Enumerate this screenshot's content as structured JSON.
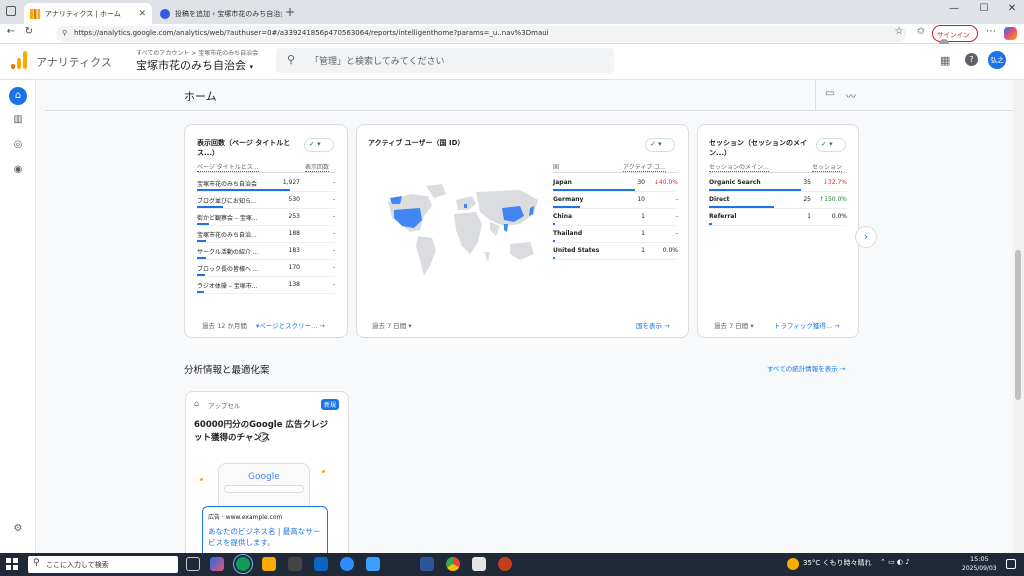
{
  "browser": {
    "tabs": [
      {
        "title": "アナリティクス | ホーム",
        "active": true
      },
      {
        "title": "投稿を追加 ‹ 宝塚市花のみち自治会",
        "active": false
      }
    ],
    "url": "https://analytics.google.com/analytics/web/?authuser=0#/a339241856p470563064/reports/intelligenthome?params=_u..nav%3Dmaui",
    "signin_label": "サインイン"
  },
  "ga": {
    "product": "アナリティクス",
    "breadcrumb": "すべてのアカウント > 宝塚市花のみち自治会",
    "property": "宝塚市花のみち自治会",
    "search_placeholder": "「管理」と検索してみてください",
    "avatar": "弘之"
  },
  "page": {
    "title": "ホーム"
  },
  "card_pages": {
    "title": "表示回数（ページ タイトルとス...）",
    "col1": "ページ タイトルとス...",
    "col2": "表示回数",
    "rows": [
      {
        "label": "宝塚市花のみち自治会",
        "value": "1,927",
        "delta": "-",
        "pct": 1.0
      },
      {
        "label": "ブログ並びにお知ら...",
        "value": "530",
        "delta": "-",
        "pct": 0.28
      },
      {
        "label": "街かど観察会 – 宝塚...",
        "value": "253",
        "delta": "-",
        "pct": 0.13
      },
      {
        "label": "宝塚市花のみち自治...",
        "value": "188",
        "delta": "-",
        "pct": 0.1
      },
      {
        "label": "サークル活動の紹介 ...",
        "value": "183",
        "delta": "-",
        "pct": 0.1
      },
      {
        "label": "ブロック長の皆様へ ...",
        "value": "170",
        "delta": "-",
        "pct": 0.09
      },
      {
        "label": "ラジオ体操 – 宝塚市...",
        "value": "138",
        "delta": "-",
        "pct": 0.07
      }
    ],
    "period": "過去 12 か月間",
    "link": "ページとスクリー..."
  },
  "card_users": {
    "title": "アクティブ ユーザー（国 ID）",
    "col1": "国",
    "col2": "アクティブ ユ...",
    "rows": [
      {
        "label": "Japan",
        "value": "30",
        "delta": "↓40.0%",
        "dir": "down",
        "pct": 1.0
      },
      {
        "label": "Germany",
        "value": "10",
        "delta": "-",
        "dir": "none",
        "pct": 0.33
      },
      {
        "label": "China",
        "value": "1",
        "delta": "-",
        "dir": "none",
        "pct": 0.03
      },
      {
        "label": "Thailand",
        "value": "1",
        "delta": "-",
        "dir": "none",
        "pct": 0.03
      },
      {
        "label": "United States",
        "value": "1",
        "delta": "0.0%",
        "dir": "none",
        "pct": 0.03
      }
    ],
    "period": "過去 7 日間",
    "link": "国を表示"
  },
  "card_sessions": {
    "title": "セッション（セッションのメイン...）",
    "col1": "セッションのメイン...",
    "col2": "セッション",
    "rows": [
      {
        "label": "Organic Search",
        "value": "35",
        "delta": "↓32.7%",
        "dir": "down",
        "pct": 1.0
      },
      {
        "label": "Direct",
        "value": "25",
        "delta": "↑150.0%",
        "dir": "up",
        "pct": 0.71
      },
      {
        "label": "Referral",
        "value": "1",
        "delta": "0.0%",
        "dir": "none",
        "pct": 0.03
      }
    ],
    "period": "過去 7 日間",
    "link": "トラフィック獲得..."
  },
  "insights": {
    "title": "分析情報と最適化案",
    "link": "すべての統計情報を表示",
    "card": {
      "tag": "アップセル",
      "badge": "新規",
      "headline": "60000円分のGoogle 広告クレジット獲得のチャンス",
      "google_logo": "Google",
      "ad_label": "広告 · www.example.com",
      "ad_text": "あなたのビジネス名 | 最高なサービスを提供します。"
    }
  },
  "taskbar": {
    "search": "ここに入力して検索",
    "weather": "35°C くもり時々晴れ",
    "time": "15:05",
    "date": "2025/09/03"
  },
  "colors": {
    "accent": "#1a73e8",
    "ga_orange": "#f9ab00",
    "map_land": "#dadce0",
    "map_hi": "#4285f4"
  }
}
